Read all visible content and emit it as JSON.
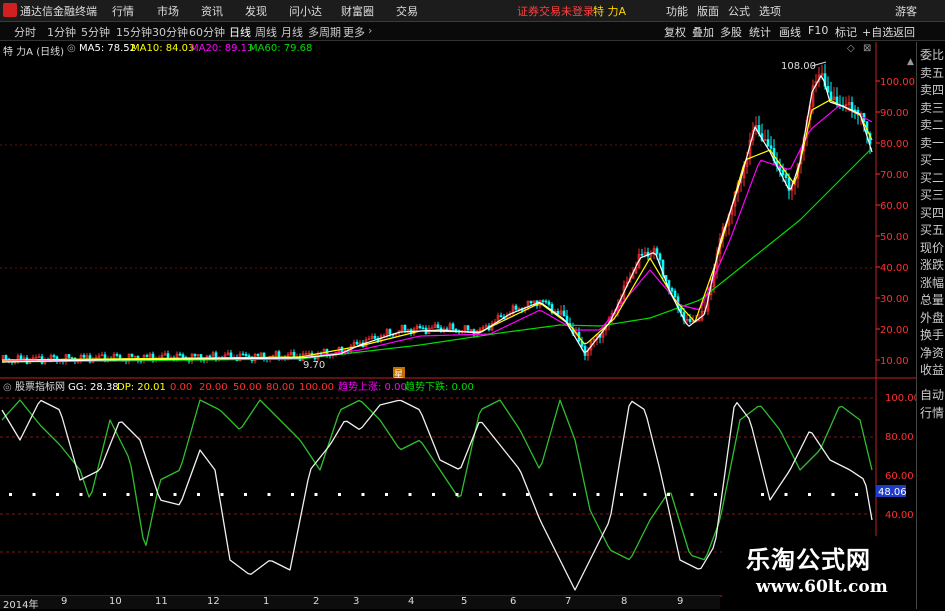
{
  "window": {
    "app_title": "通达信金融终端",
    "menu": [
      "行情",
      "市场",
      "资讯",
      "发现",
      "问小达",
      "财富圈",
      "交易"
    ],
    "trade_status": "证券交易未登录",
    "stock_name": "特 力A",
    "right_menu": [
      "功能",
      "版面",
      "公式",
      "选项"
    ],
    "guest": "游客"
  },
  "toolbar": {
    "periods": [
      "分时",
      "1分钟",
      "5分钟",
      "15分钟",
      "30分钟",
      "60分钟",
      "日线",
      "周线",
      "月线",
      "多周期",
      "更多"
    ],
    "active_period": "日线",
    "right_buttons": [
      "复权",
      "叠加",
      "多股",
      "统计",
      "画线",
      "F10",
      "标记",
      "+自选",
      "返回"
    ]
  },
  "main_chart": {
    "title": "特 力A (日线)",
    "ma5_label": "MA5: 78.52",
    "ma10_label": "MA10: 84.03",
    "ma20_label": "MA20: 89.13",
    "ma60_label": "MA60: 79.68",
    "high_annotation": "108.00",
    "low_annotation": "9.70",
    "marker_label": "星",
    "y_ticks": [
      "100.00",
      "90.00",
      "80.00",
      "70.00",
      "60.00",
      "50.00",
      "40.00",
      "30.00",
      "20.00",
      "10.00"
    ],
    "colors": {
      "ma5": "#ffffff",
      "ma10": "#ffff00",
      "ma20": "#ff00ff",
      "ma60": "#00dd00",
      "up": "#ff3030",
      "down": "#00ffff",
      "axis": "#ff3030"
    }
  },
  "indicator": {
    "name": "股票指标网",
    "gg_label": "GG: 28.38",
    "dp_label": "DP: 20.01",
    "levels": [
      "0.00",
      "20.00",
      "50.00",
      "80.00",
      "100.00"
    ],
    "up_label": "趋势上涨: 0.00",
    "down_label": "趋势下跌: 0.00",
    "y_ticks": [
      "100.00",
      "80.00",
      "60.00",
      "40.00"
    ],
    "current_value": "48.06"
  },
  "x_axis": [
    "2014年",
    "9",
    "10",
    "11",
    "12",
    "1",
    "2",
    "3",
    "4",
    "5",
    "6",
    "7",
    "8",
    "9"
  ],
  "side_panel": [
    "委比",
    "卖五",
    "卖四",
    "卖三",
    "卖二",
    "卖一",
    "买一",
    "买二",
    "买三",
    "买四",
    "买五",
    "现价",
    "涨跌",
    "涨幅",
    "总量",
    "外盘",
    "换手",
    "净资",
    "收益"
  ],
  "side_panel_bottom": [
    "自动",
    "行情"
  ],
  "watermark": {
    "title": "乐淘公式网",
    "url": "www.60lt.com"
  }
}
